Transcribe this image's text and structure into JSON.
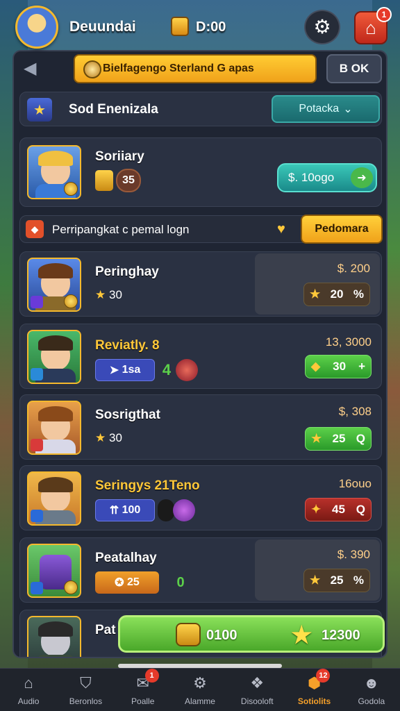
{
  "header": {
    "player_name": "Deuundai",
    "timer": "D:00",
    "home_badge": "1"
  },
  "banner": {
    "text": "Bielfagengo Sterland G apas",
    "book_label": "B OK"
  },
  "section": {
    "title": "Sod Enenizala",
    "dropdown_value": "Potacka"
  },
  "featured": {
    "title": "Soriiary",
    "level": "35",
    "price_label": "$. 10ogo"
  },
  "filter": {
    "label": "Perripangkat c pemal logn",
    "button_label": "Pedomara"
  },
  "items": [
    {
      "title": "Peringhay",
      "stat": "30",
      "price": "$. 200",
      "chip_value": "20",
      "chip_tail": "%",
      "title_color": "#ffffff"
    },
    {
      "title": "Reviatly. 8",
      "stat": "1sa",
      "extra": "4",
      "price": "13, 3000",
      "chip_value": "30",
      "chip_tail": "+",
      "title_color": "#ffc83a"
    },
    {
      "title": "Sosrigthat",
      "stat": "30",
      "price": "$, 308",
      "chip_value": "25",
      "chip_tail": "Q",
      "title_color": "#ffffff"
    },
    {
      "title": "Seringys 21Teno",
      "stat": "100",
      "price": "16ouo",
      "chip_value": "45",
      "chip_tail": "Q",
      "title_color": "#ffc83a"
    },
    {
      "title": "Peatalhay",
      "stat": "25",
      "extra": "0",
      "price": "$. 390",
      "chip_value": "25",
      "chip_tail": "%",
      "title_color": "#ffffff"
    },
    {
      "title": "Pat",
      "title_color": "#ffffff"
    }
  ],
  "buy_bar": {
    "left_amount": "0100",
    "right_amount": "12300"
  },
  "nav": [
    {
      "label": "Audio",
      "icon": "home-icon"
    },
    {
      "label": "Beronlos",
      "icon": "shield-icon"
    },
    {
      "label": "Poalle",
      "icon": "chat-icon",
      "badge": "1"
    },
    {
      "label": "Alamme",
      "icon": "gear-icon"
    },
    {
      "label": "Disooloft",
      "icon": "gift-icon"
    },
    {
      "label": "Sotiolits",
      "icon": "bag-icon",
      "badge": "12",
      "active": true
    },
    {
      "label": "Godola",
      "icon": "user-icon"
    }
  ],
  "colors": {
    "panel_bg": "#1f2533",
    "accent_gold": "#ffc83a",
    "accent_green": "#5cd04a",
    "accent_teal": "#2a8a8a"
  }
}
